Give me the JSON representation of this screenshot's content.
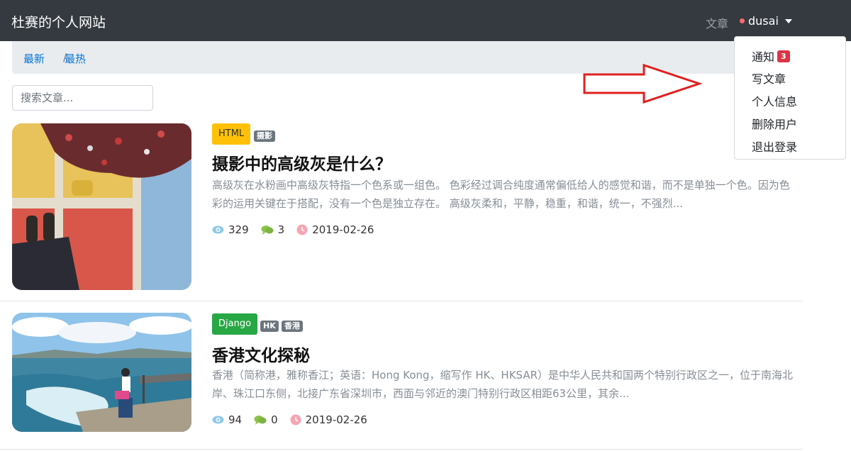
{
  "navbar": {
    "brand": "杜赛的个人网站",
    "articles_link": "文章",
    "user_name": "dusai"
  },
  "breadcrumb": {
    "latest": "最新",
    "separator": "/",
    "hottest": "最热"
  },
  "search": {
    "placeholder": "搜索文章..."
  },
  "dropdown": {
    "notify": "通知",
    "notify_count": "3",
    "write": "写文章",
    "profile": "个人信息",
    "delete_user": "删除用户",
    "logout": "退出登录"
  },
  "articles": [
    {
      "column": "HTML",
      "column_color": "#ffc107",
      "tags": [
        "摄影"
      ],
      "title": "摄影中的高级灰是什么？",
      "excerpt": "高级灰在水粉画中高级灰特指一个色系或一组色。 色彩经过调合纯度通常偏低给人的感觉和谐，而不是单独一个色。因为色彩的运用关键在于搭配，没有一个色是独立存在。 高级灰柔和，平静，稳重，和谐，统一，不强烈...",
      "views": "329",
      "comments": "3",
      "date": "2019-02-26"
    },
    {
      "column": "Django",
      "column_color": "#28a745",
      "tags": [
        "HK",
        "香港"
      ],
      "title": "香港文化探秘",
      "excerpt": "香港（简称港，雅称香江；英语：Hong Kong，缩写作 HK、HKSAR）是中华人民共和国两个特别行政区之一，位于南海北岸、珠江口东侧，北接广东省深圳市，西面与邻近的澳门特别行政区相距63公里，其余...",
      "views": "94",
      "comments": "0",
      "date": "2019-02-26"
    }
  ],
  "colors": {
    "navbar_bg": "#343a40",
    "link_blue": "#0275d8",
    "annotation_arrow": "#e02020"
  }
}
